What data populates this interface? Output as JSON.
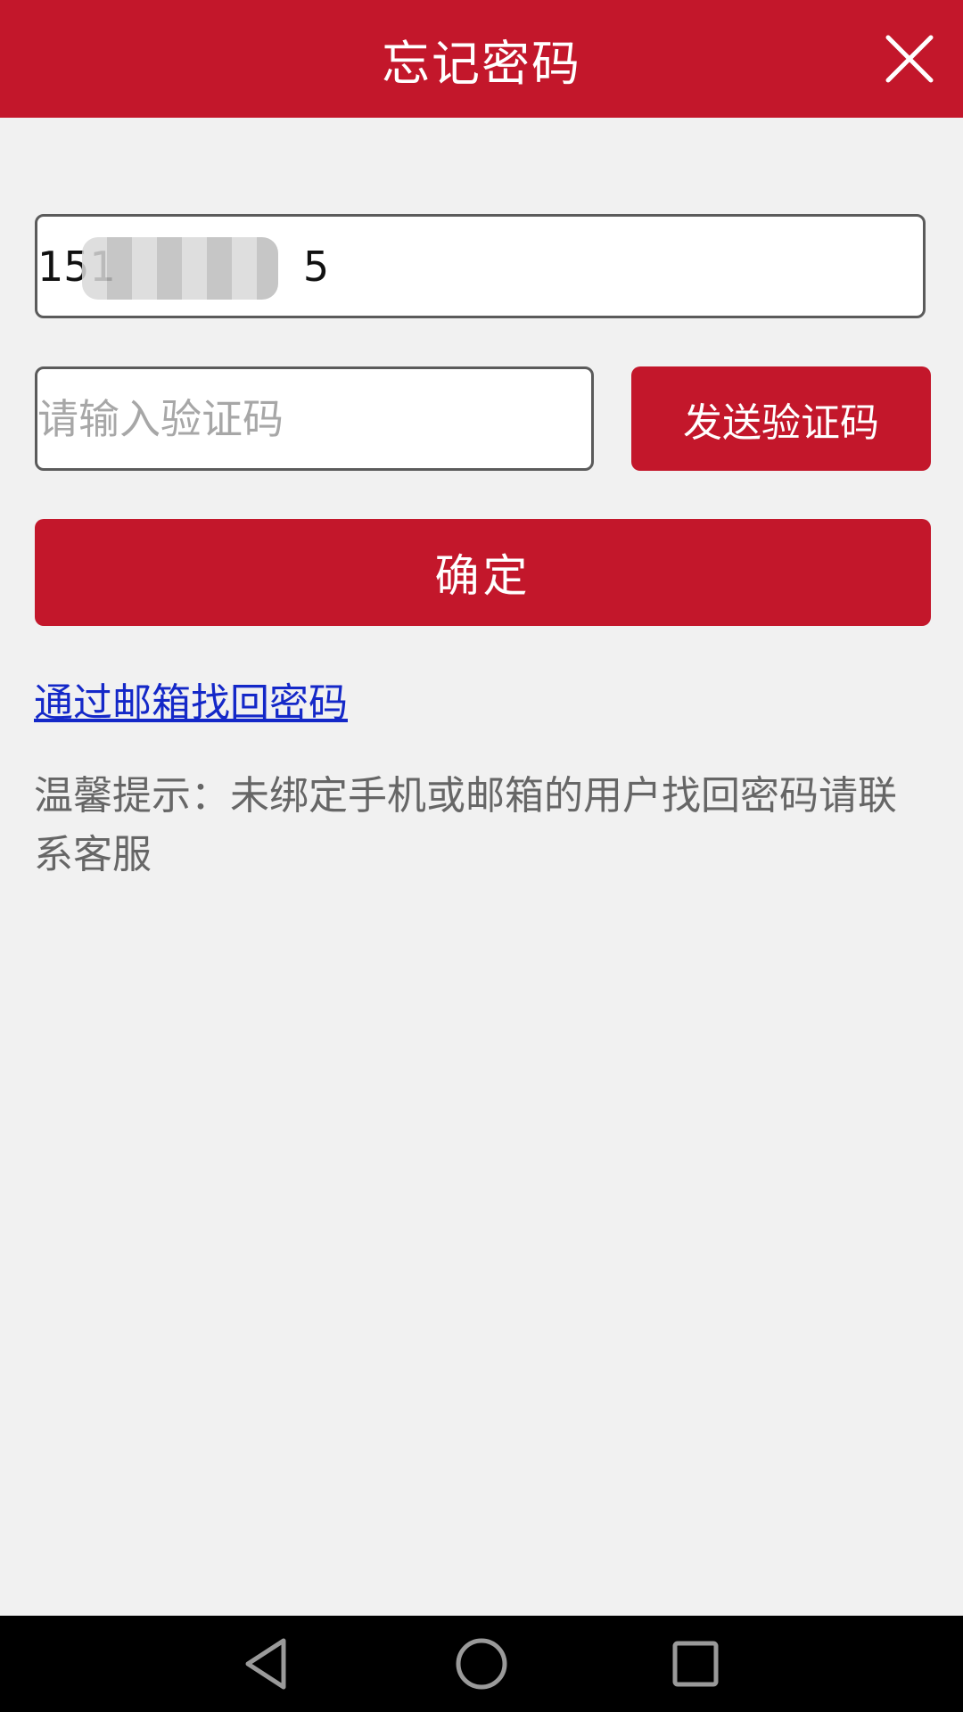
{
  "header": {
    "title": "忘记密码",
    "close_icon": "close-icon"
  },
  "form": {
    "phone_value": "151",
    "phone_value_tail": "5",
    "code_placeholder": "请输入验证码",
    "send_code_label": "发送验证码",
    "confirm_label": "确定"
  },
  "links": {
    "email_recover": "通过邮箱找回密码"
  },
  "tip": {
    "text": "温馨提示：未绑定手机或邮箱的用户找回密码请联系客服"
  },
  "navbar": {
    "back_icon": "back-triangle-icon",
    "home_icon": "home-circle-icon",
    "recents_icon": "recents-square-icon"
  },
  "colors": {
    "brand": "#c3172b",
    "background": "#f1f1f1",
    "link": "#1428c8",
    "tip_text": "#666666"
  }
}
